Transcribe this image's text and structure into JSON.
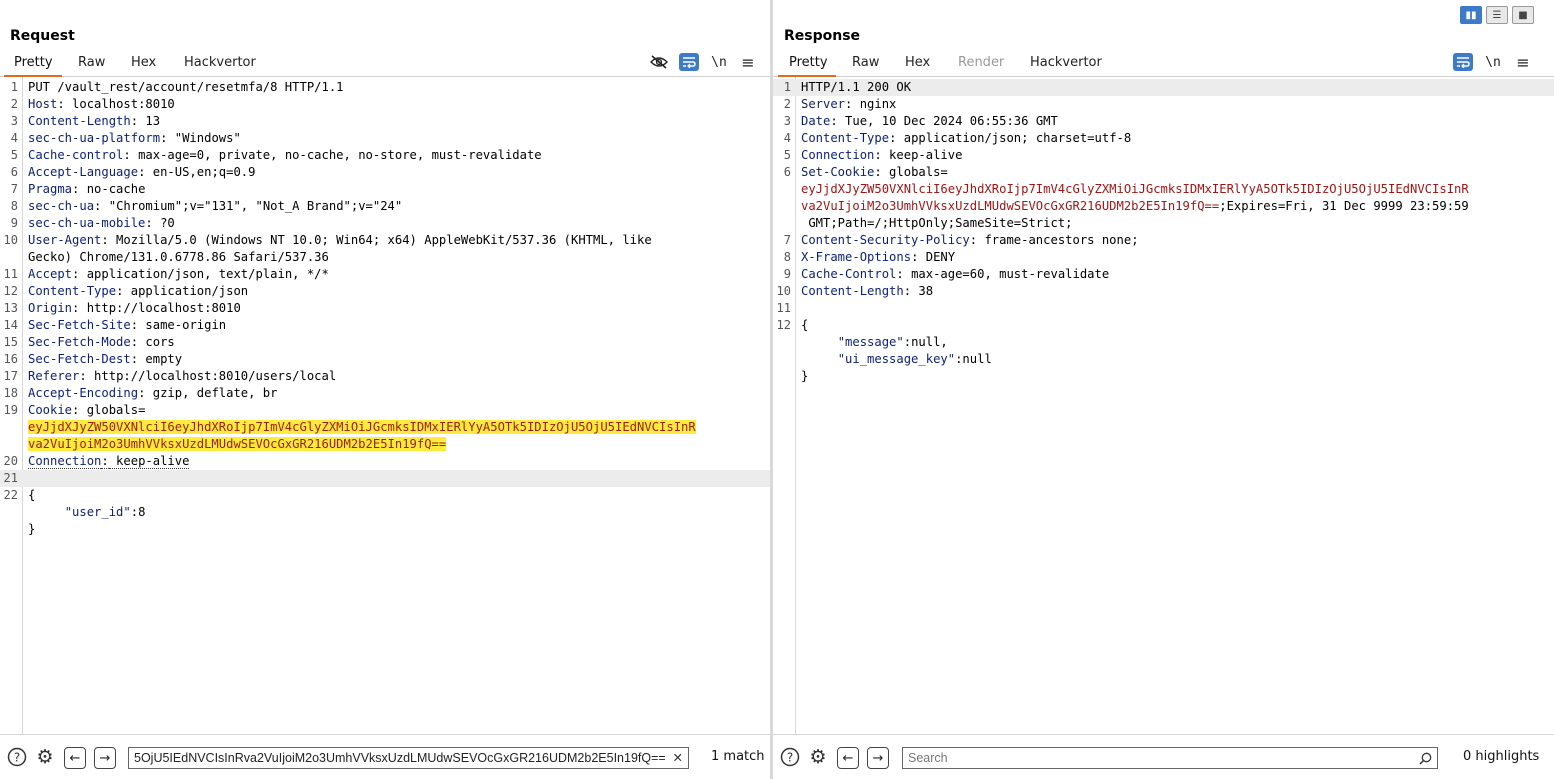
{
  "request": {
    "title": "Request",
    "tabs": [
      "Pretty",
      "Raw",
      "Hex",
      "Hackvertor"
    ],
    "toolbar_icons": [
      "eye-slash-icon",
      "word-wrap-icon",
      "newline-toggle-icon",
      "menu-icon"
    ],
    "newline_label": "\\n",
    "lines": [
      {
        "n": "1",
        "text": "PUT /vault_rest/account/resetmfa/8 HTTP/1.1"
      },
      {
        "n": "2",
        "key": "Host",
        "val": " localhost:8010"
      },
      {
        "n": "3",
        "key": "Content-Length",
        "val": " 13"
      },
      {
        "n": "4",
        "key": "sec-ch-ua-platform",
        "val": " \"Windows\""
      },
      {
        "n": "5",
        "key": "Cache-control",
        "val": " max-age=0, private, no-cache, no-store, must-revalidate"
      },
      {
        "n": "6",
        "key": "Accept-Language",
        "val": " en-US,en;q=0.9"
      },
      {
        "n": "7",
        "key": "Pragma",
        "val": " no-cache"
      },
      {
        "n": "8",
        "key": "sec-ch-ua",
        "val": " \"Chromium\";v=\"131\", \"Not_A Brand\";v=\"24\""
      },
      {
        "n": "9",
        "key": "sec-ch-ua-mobile",
        "val": " ?0"
      },
      {
        "n": "10",
        "key": "User-Agent",
        "val": " Mozilla/5.0 (Windows NT 10.0; Win64; x64) AppleWebKit/537.36 (KHTML, like"
      },
      {
        "n": "",
        "text": "Gecko) Chrome/131.0.6778.86 Safari/537.36"
      },
      {
        "n": "11",
        "key": "Accept",
        "val": " application/json, text/plain, */*"
      },
      {
        "n": "12",
        "key": "Content-Type",
        "val": " application/json"
      },
      {
        "n": "13",
        "key": "Origin",
        "val": " http://localhost:8010"
      },
      {
        "n": "14",
        "key": "Sec-Fetch-Site",
        "val": " same-origin"
      },
      {
        "n": "15",
        "key": "Sec-Fetch-Mode",
        "val": " cors"
      },
      {
        "n": "16",
        "key": "Sec-Fetch-Dest",
        "val": " empty"
      },
      {
        "n": "17",
        "key": "Referer",
        "val": " http://localhost:8010/users/local"
      },
      {
        "n": "18",
        "key": "Accept-Encoding",
        "val": " gzip, deflate, br"
      },
      {
        "n": "19",
        "key": "Cookie",
        "val": " globals="
      },
      {
        "n": "",
        "highlight": "eyJjdXJyZW50VXNlciI6eyJhdXRoIjp7ImV4cGlyZXMiOiJGcmksIDMxIERlYyA5OTk5IDIzOjU5OjU5IEdNVCIsInR"
      },
      {
        "n": "",
        "highlight": "va2VuIjoiM2o3UmhVVksxUzdLMUdwSEVOcGxGR216UDM2b2E5In19fQ=="
      },
      {
        "n": "20",
        "key": "Connection",
        "val": " keep-alive",
        "dotted": true
      },
      {
        "n": "21",
        "text": "",
        "current": true
      },
      {
        "n": "22",
        "text": "{"
      },
      {
        "n": "",
        "json_key": "\"user_id\"",
        "json_val": ":8"
      },
      {
        "n": "",
        "text": "}"
      }
    ],
    "search_value": "5OjU5IEdNVCIsInRva2VuIjoiM2o3UmhVVksxUzdLMUdwSEVOcGxGR216UDM2b2E5In19fQ==",
    "match_count": "1 match"
  },
  "response": {
    "title": "Response",
    "tabs": [
      "Pretty",
      "Raw",
      "Hex",
      "Render",
      "Hackvertor"
    ],
    "toolbar_icons": [
      "word-wrap-icon",
      "newline-toggle-icon",
      "menu-icon"
    ],
    "newline_label": "\\n",
    "lines": [
      {
        "n": "1",
        "text": "HTTP/1.1 200 OK",
        "current": true
      },
      {
        "n": "2",
        "key": "Server",
        "val": " nginx"
      },
      {
        "n": "3",
        "key": "Date",
        "val": " Tue, 10 Dec 2024 06:55:36 GMT"
      },
      {
        "n": "4",
        "key": "Content-Type",
        "val": " application/json; charset=utf-8"
      },
      {
        "n": "5",
        "key": "Connection",
        "val": " keep-alive"
      },
      {
        "n": "6",
        "key": "Set-Cookie",
        "val": " globals="
      },
      {
        "n": "",
        "cookie": "eyJjdXJyZW50VXNlciI6eyJhdXRoIjp7ImV4cGlyZXMiOiJGcmksIDMxIERlYyA5OTk5IDIzOjU5OjU5IEdNVCIsInR"
      },
      {
        "n": "",
        "cookie": "va2VuIjoiM2o3UmhVVksxUzdLMUdwSEVOcGxGR216UDM2b2E5In19fQ==",
        "rest": ";Expires=Fri, 31 Dec 9999 23:59:59"
      },
      {
        "n": "",
        "text": " GMT;Path=/;HttpOnly;SameSite=Strict;"
      },
      {
        "n": "7",
        "key": "Content-Security-Policy",
        "val": " frame-ancestors none;"
      },
      {
        "n": "8",
        "key": "X-Frame-Options",
        "val": " DENY"
      },
      {
        "n": "9",
        "key": "Cache-Control",
        "val": " max-age=60, must-revalidate"
      },
      {
        "n": "10",
        "key": "Content-Length",
        "val": " 38"
      },
      {
        "n": "11",
        "text": ""
      },
      {
        "n": "12",
        "text": "{"
      },
      {
        "n": "",
        "json_key": "\"message\"",
        "json_val": ":null,"
      },
      {
        "n": "",
        "json_key": "\"ui_message_key\"",
        "json_val": ":null"
      },
      {
        "n": "",
        "text": "}"
      }
    ],
    "search_placeholder": "Search",
    "highlight_count": "0 highlights"
  },
  "layout_buttons": [
    "split-columns-icon",
    "split-rows-icon",
    "single-pane-icon"
  ],
  "accent_color": "#e36a1f",
  "highlight_color": "#ffeb3b",
  "toggle_color": "#3d7bc6"
}
